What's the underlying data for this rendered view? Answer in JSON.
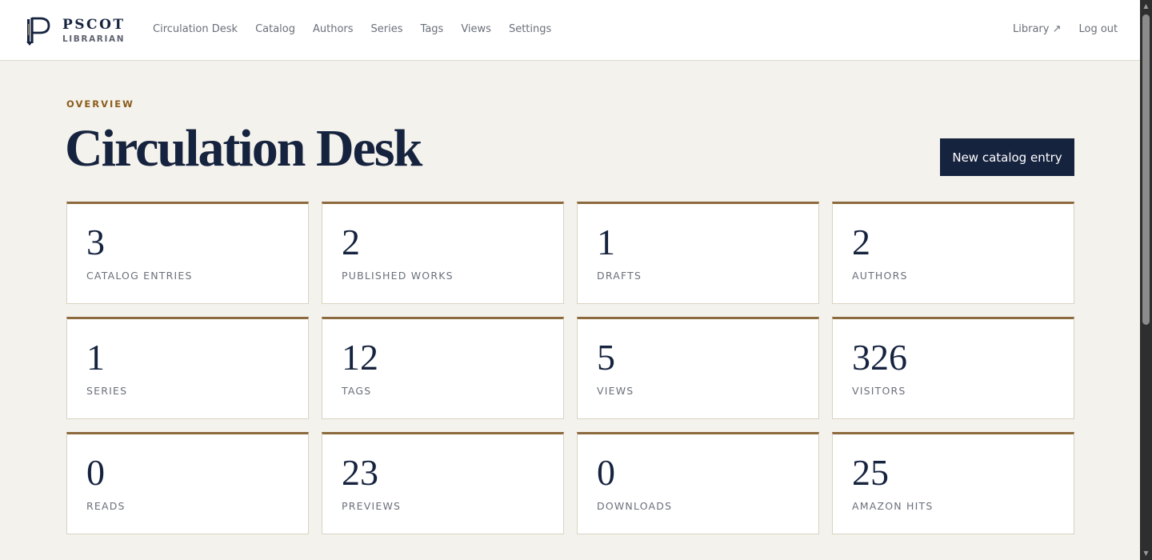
{
  "brand": {
    "name": "PSCOT",
    "subtitle": "LIBRARIAN"
  },
  "nav": {
    "items": [
      {
        "label": "Circulation Desk"
      },
      {
        "label": "Catalog"
      },
      {
        "label": "Authors"
      },
      {
        "label": "Series"
      },
      {
        "label": "Tags"
      },
      {
        "label": "Views"
      },
      {
        "label": "Settings"
      }
    ],
    "library_label": "Library ↗",
    "logout_label": "Log out"
  },
  "main": {
    "eyebrow": "OVERVIEW",
    "title": "Circulation Desk",
    "new_entry_label": "New catalog entry"
  },
  "stats": [
    {
      "value": "3",
      "label": "CATALOG ENTRIES"
    },
    {
      "value": "2",
      "label": "PUBLISHED WORKS"
    },
    {
      "value": "1",
      "label": "DRAFTS"
    },
    {
      "value": "2",
      "label": "AUTHORS"
    },
    {
      "value": "1",
      "label": "SERIES"
    },
    {
      "value": "12",
      "label": "TAGS"
    },
    {
      "value": "5",
      "label": "VIEWS"
    },
    {
      "value": "326",
      "label": "VISITORS"
    },
    {
      "value": "0",
      "label": "READS"
    },
    {
      "value": "23",
      "label": "PREVIEWS"
    },
    {
      "value": "0",
      "label": "DOWNLOADS"
    },
    {
      "value": "25",
      "label": "AMAZON HITS"
    }
  ],
  "colors": {
    "navy": "#16233f",
    "accent_gold": "#8d6a3e",
    "eyebrow_brown": "#8a5b1c",
    "page_bg": "#f4f2ec"
  },
  "icons": {
    "logo": "pen-nib-p-logo-icon"
  }
}
